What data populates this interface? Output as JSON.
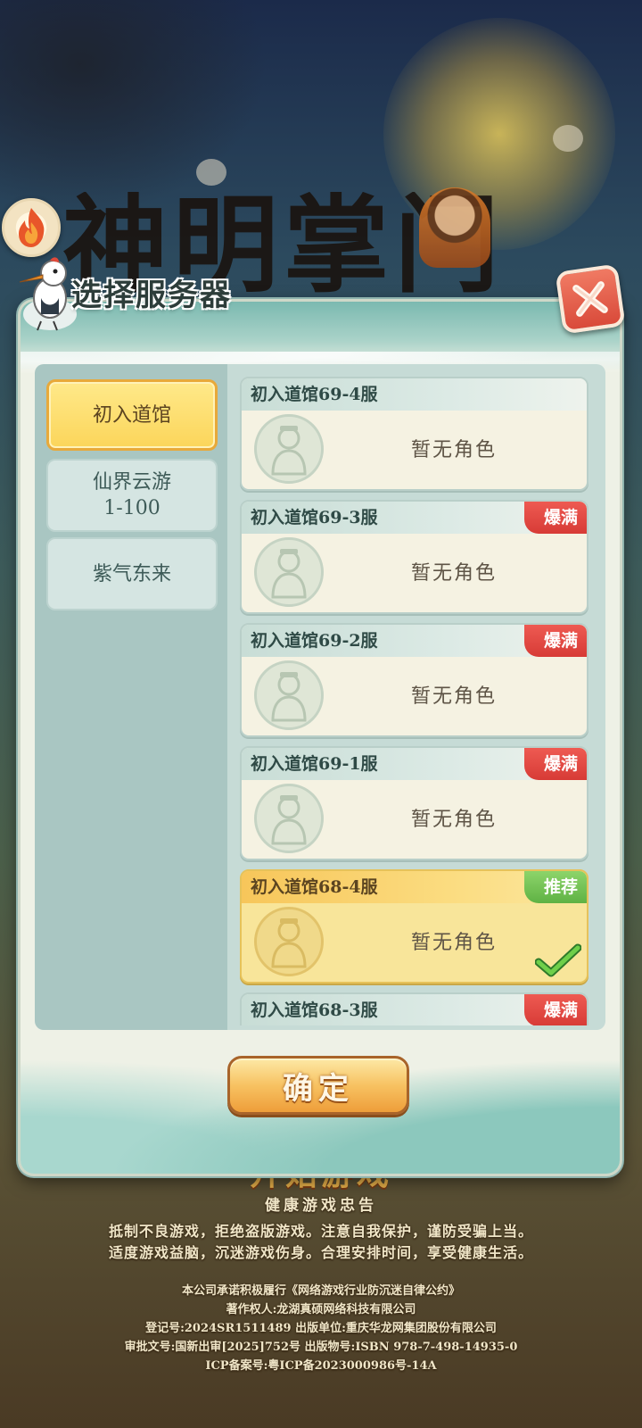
{
  "background": {
    "game_title": "神明掌门",
    "start_text": "开始游戏"
  },
  "dialog": {
    "title": "选择服务器",
    "confirm_label": "确定"
  },
  "categories": [
    {
      "label": "初入道馆",
      "active": true
    },
    {
      "label": "仙界云游\n1-100",
      "active": false
    },
    {
      "label": "紫气东来",
      "active": false
    }
  ],
  "servers": [
    {
      "name": "初入道馆69-4服",
      "status": "暂无角色",
      "badge": "",
      "selected": false
    },
    {
      "name": "初入道馆69-3服",
      "status": "暂无角色",
      "badge": "爆满",
      "selected": false
    },
    {
      "name": "初入道馆69-2服",
      "status": "暂无角色",
      "badge": "爆满",
      "selected": false
    },
    {
      "name": "初入道馆69-1服",
      "status": "暂无角色",
      "badge": "爆满",
      "selected": false
    },
    {
      "name": "初入道馆68-4服",
      "status": "暂无角色",
      "badge": "推荐",
      "selected": true
    },
    {
      "name": "初入道馆68-3服",
      "status": "",
      "badge": "爆满",
      "selected": false
    }
  ],
  "footer": {
    "motto_title": "健康游戏忠告",
    "motto_1": "抵制不良游戏，拒绝盗版游戏。注意自我保护，谨防受骗上当。",
    "motto_2": "适度游戏益脑，沉迷游戏伤身。合理安排时间，享受健康生活。",
    "line_1": "本公司承诺积极履行《网络游戏行业防沉迷自律公约》",
    "line_2": "著作权人:龙湖真硕网络科技有限公司",
    "line_3": "登记号:2024SR1511489  出版单位:重庆华龙网集团股份有限公司",
    "line_4": "审批文号:国新出审[2025]752号  出版物号:ISBN 978-7-498-14935-0",
    "line_5": "ICP备案号:粤ICP备2023000986号-14A"
  },
  "colors": {
    "badge_full": "#d73b36",
    "badge_recommend": "#5fb244",
    "active_category": "#fbd55a",
    "confirm_button": "#f7c262"
  },
  "icons": [
    "fire-phoenix-icon",
    "crane-mascot-icon",
    "close-icon",
    "character-avatar-icon",
    "check-icon"
  ]
}
